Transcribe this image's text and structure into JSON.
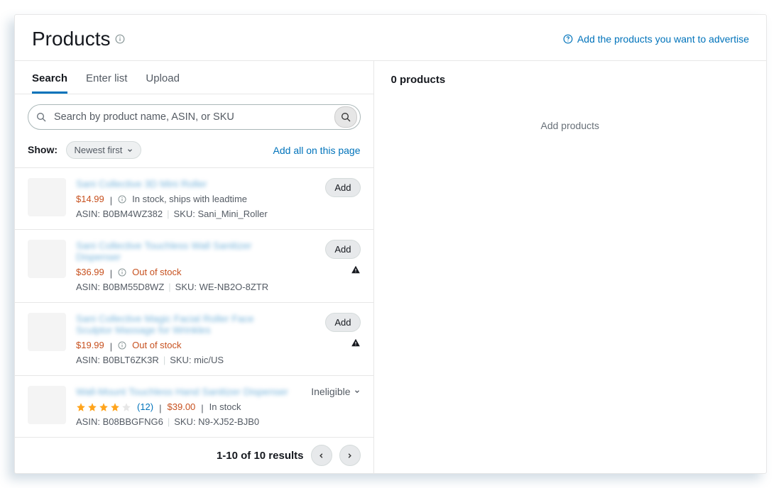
{
  "header": {
    "title": "Products",
    "help_link": "Add the products you want to advertise"
  },
  "tabs": [
    "Search",
    "Enter list",
    "Upload"
  ],
  "active_tab": 0,
  "search": {
    "placeholder": "Search by product name, ASIN, or SKU"
  },
  "controls": {
    "show_label": "Show:",
    "sort": "Newest first",
    "add_all": "Add all on this page"
  },
  "products": [
    {
      "name": "Sani Collective 3D Mini Roller",
      "price": "$14.99",
      "stock": "In stock, ships with leadtime",
      "stock_status": "ok",
      "asin": "B0BM4WZ382",
      "sku": "Sani_Mini_Roller",
      "action": "add"
    },
    {
      "name": "Sani Collective Touchless Wall Sanitizer Dispenser",
      "price": "$36.99",
      "stock": "Out of stock",
      "stock_status": "out",
      "asin": "B0BM55D8WZ",
      "sku": "WE-NB2O-8ZTR",
      "action": "add",
      "warn": true
    },
    {
      "name": "Sani Collective Magic Facial Roller Face Sculptor Massage for Wrinkles",
      "price": "$19.99",
      "stock": "Out of stock",
      "stock_status": "out",
      "asin": "B0BLT6ZK3R",
      "sku": "mic/US",
      "action": "add",
      "warn": true
    },
    {
      "name": "Wall-Mount Touchless Hand Sanitizer Dispenser",
      "price": "$39.00",
      "stock": "In stock",
      "stock_status": "ok",
      "asin": "B08BBGFNG6",
      "sku": "N9-XJ52-BJB0",
      "action": "ineligible",
      "rating": 4,
      "reviews": "(12)"
    }
  ],
  "add_button_label": "Add",
  "ineligible_label": "Ineligible",
  "pagination": {
    "text": "1-10 of 10 results"
  },
  "right": {
    "count_label": "0 products",
    "empty": "Add products"
  }
}
